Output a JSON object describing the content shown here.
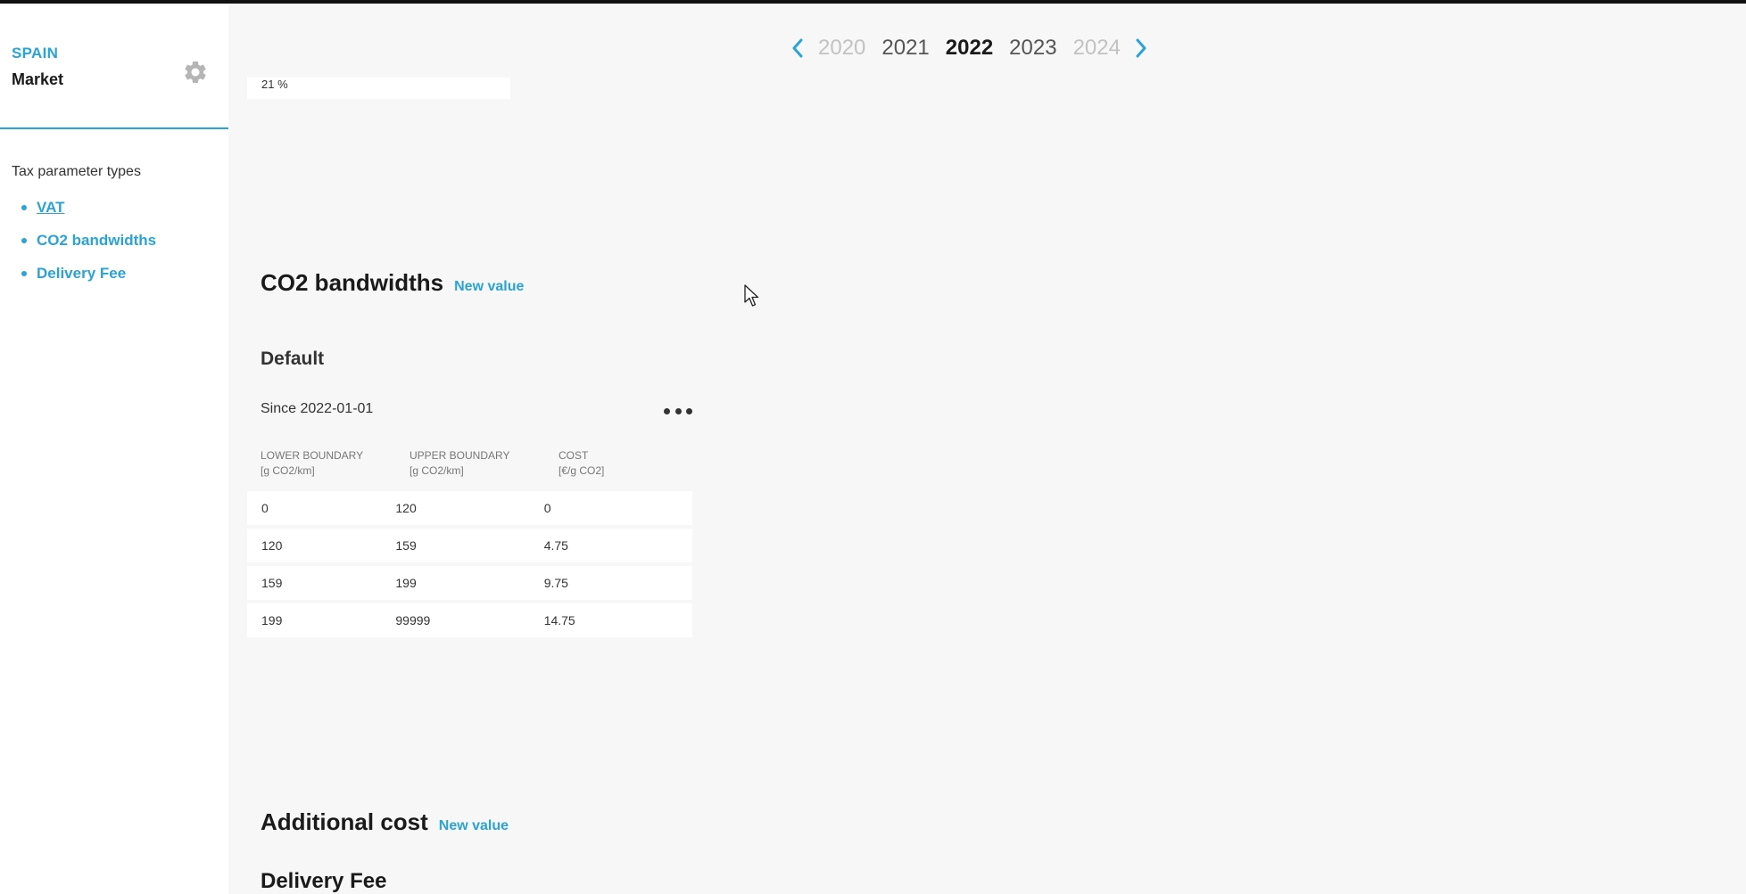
{
  "sidebar": {
    "country": "SPAIN",
    "market": "Market",
    "types_label": "Tax parameter types",
    "items": [
      {
        "label": "VAT"
      },
      {
        "label": "CO2 bandwidths"
      },
      {
        "label": "Delivery Fee"
      }
    ]
  },
  "year_nav": {
    "years": [
      "2020",
      "2021",
      "2022",
      "2023",
      "2024"
    ],
    "current": "2022"
  },
  "vat": {
    "value": "21 %"
  },
  "co2": {
    "title": "CO2 bandwidths",
    "new_value": "New value",
    "subsection": "Default",
    "since": "Since 2022-01-01",
    "columns": [
      {
        "name": "LOWER BOUNDARY",
        "unit": "[g CO2/km]"
      },
      {
        "name": "UPPER BOUNDARY",
        "unit": "[g CO2/km]"
      },
      {
        "name": "COST",
        "unit": "[€/g CO2]"
      }
    ],
    "rows": [
      [
        "0",
        "120",
        "0"
      ],
      [
        "120",
        "159",
        "4.75"
      ],
      [
        "159",
        "199",
        "9.75"
      ],
      [
        "199",
        "99999",
        "14.75"
      ]
    ]
  },
  "additional": {
    "title": "Additional cost",
    "new_value": "New value",
    "subsection": "Delivery Fee"
  },
  "colors": {
    "accent": "#2aa3d6",
    "background": "#f7f7f7",
    "sidebar": "#ffffff"
  },
  "icons": {
    "settings": "gear-icon",
    "prev": "chevron-left-icon",
    "next": "chevron-right-icon",
    "more": "more-horizontal-icon"
  }
}
